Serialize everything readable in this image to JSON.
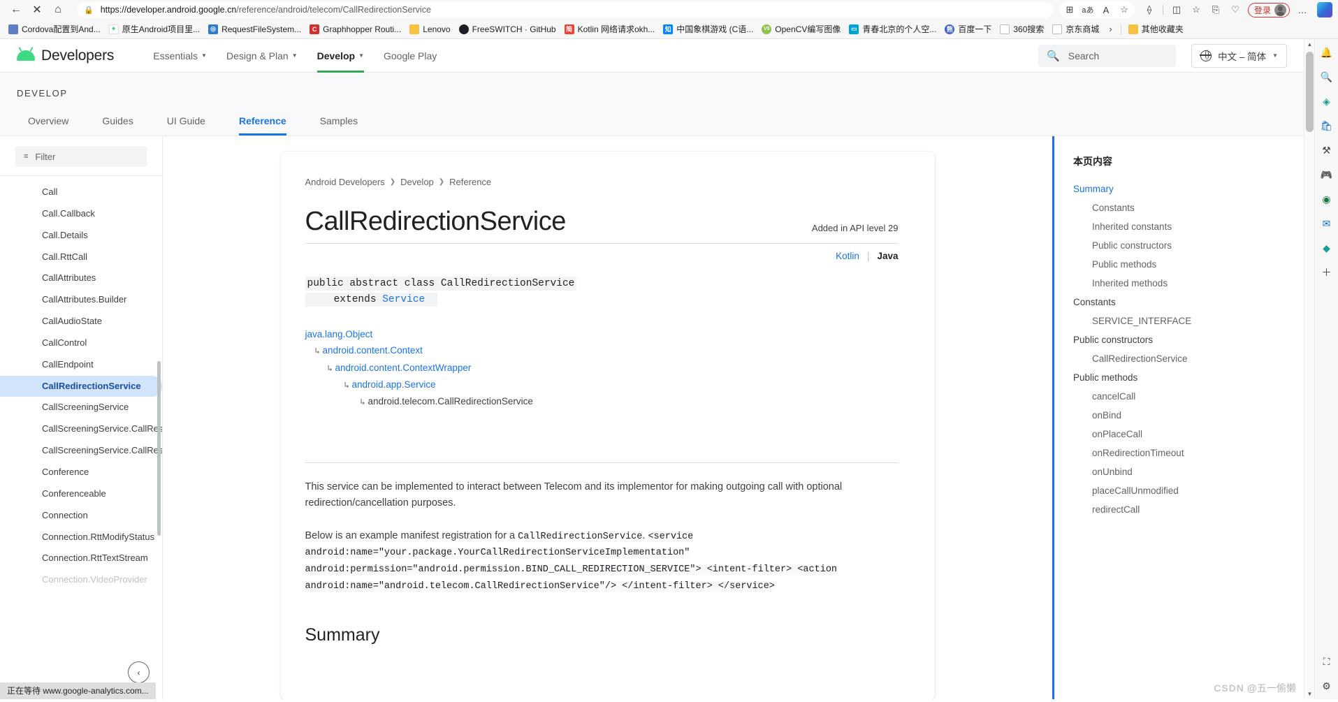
{
  "browser": {
    "nav": {
      "back": "←",
      "close": "✕",
      "home": "⌂"
    },
    "address": {
      "lock_icon": "lock-icon",
      "url_prefix": "https://developer.android.google.cn",
      "url_suffix": "/reference/android/telecom/CallRedirectionService"
    },
    "toolbar_icons": [
      {
        "name": "split-screen-icon",
        "glyph": "⊞"
      },
      {
        "name": "translate-icon",
        "glyph": "aあ"
      },
      {
        "name": "read-aloud-icon",
        "glyph": "A"
      },
      {
        "name": "favorite-star-icon",
        "glyph": "☆"
      },
      {
        "name": "extensions-icon",
        "glyph": "⟠"
      },
      {
        "name": "split-window-icon",
        "glyph": "◫"
      },
      {
        "name": "collections-icon",
        "glyph": "☆≡"
      },
      {
        "name": "add-tab-group-icon",
        "glyph": "⎘"
      },
      {
        "name": "browser-essentials-icon",
        "glyph": "♡"
      }
    ],
    "signin": {
      "label": "登录",
      "avatar": "avatar"
    },
    "more_icon": "…",
    "copilot_icon": "copilot-icon",
    "bookmarks": [
      {
        "label": "Cordova配置到And...",
        "color": "#5b7ec4",
        "letter": ""
      },
      {
        "label": "原生Android项目里...",
        "color": "#ffffff",
        "letter": ""
      },
      {
        "label": "RequestFileSystem...",
        "color": "#2b7cd3",
        "letter": "◎"
      },
      {
        "label": "Graphhopper Routi...",
        "color": "#d32f2f",
        "letter": "C"
      },
      {
        "label": "Lenovo",
        "color": "#f5c242",
        "letter": ""
      },
      {
        "label": "FreeSWITCH · GitHub",
        "color": "#1b1f23",
        "letter": ""
      },
      {
        "label": "Kotlin 网络请求okh...",
        "color": "#ef4136",
        "letter": "简"
      },
      {
        "label": "中国象棋游戏 (C语...",
        "color": "#0084ff",
        "letter": "知"
      },
      {
        "label": "OpenCV编写图像",
        "color": "#8bc34a",
        "letter": "V5"
      },
      {
        "label": "青春北京的个人空...",
        "color": "#00a1d6",
        "letter": ""
      },
      {
        "label": "百度一下",
        "color": "#3b5fd9",
        "letter": ""
      },
      {
        "label": "360搜索",
        "color": "#ffffff",
        "letter": ""
      },
      {
        "label": "京东商城",
        "color": "#ffffff",
        "letter": ""
      }
    ],
    "bookmark_overflow": "›",
    "other_favorites": {
      "label": "其他收藏夹",
      "color": "#f5c242"
    },
    "status_text": "正在等待 www.google-analytics.com..."
  },
  "site": {
    "brand": "Developers",
    "nav": [
      {
        "label": "Essentials",
        "has_caret": true,
        "active": false
      },
      {
        "label": "Design & Plan",
        "has_caret": true,
        "active": false
      },
      {
        "label": "Develop",
        "has_caret": true,
        "active": true
      },
      {
        "label": "Google Play",
        "has_caret": false,
        "active": false
      }
    ],
    "search_placeholder": "Search",
    "language": "中文 – 简体",
    "section_title": "DEVELOP",
    "tabs": [
      {
        "label": "Overview",
        "active": false
      },
      {
        "label": "Guides",
        "active": false
      },
      {
        "label": "UI Guide",
        "active": false
      },
      {
        "label": "Reference",
        "active": true
      },
      {
        "label": "Samples",
        "active": false
      }
    ]
  },
  "sidebar": {
    "filter_placeholder": "Filter",
    "items": [
      {
        "label": "Call",
        "state": "normal"
      },
      {
        "label": "Call.Callback",
        "state": "normal"
      },
      {
        "label": "Call.Details",
        "state": "normal"
      },
      {
        "label": "Call.RttCall",
        "state": "normal"
      },
      {
        "label": "CallAttributes",
        "state": "normal"
      },
      {
        "label": "CallAttributes.Builder",
        "state": "normal"
      },
      {
        "label": "CallAudioState",
        "state": "normal"
      },
      {
        "label": "CallControl",
        "state": "normal"
      },
      {
        "label": "CallEndpoint",
        "state": "normal"
      },
      {
        "label": "CallRedirectionService",
        "state": "active"
      },
      {
        "label": "CallScreeningService",
        "state": "normal"
      },
      {
        "label": "CallScreeningService.CallResponse",
        "state": "normal"
      },
      {
        "label": "CallScreeningService.CallResponse.Builder",
        "state": "normal"
      },
      {
        "label": "Conference",
        "state": "normal"
      },
      {
        "label": "Conferenceable",
        "state": "normal"
      },
      {
        "label": "Connection",
        "state": "normal"
      },
      {
        "label": "Connection.RttModifyStatus",
        "state": "normal"
      },
      {
        "label": "Connection.RttTextStream",
        "state": "normal"
      },
      {
        "label": "Connection.VideoProvider",
        "state": "faded"
      }
    ],
    "collapse_icon": "‹"
  },
  "article": {
    "breadcrumb": [
      "Android Developers",
      "Develop",
      "Reference"
    ],
    "breadcrumb_sep": "❯",
    "title": "CallRedirectionService",
    "api_level": "Added in API level 29",
    "lang_kotlin": "Kotlin",
    "lang_divider": "|",
    "lang_java": "Java",
    "signature": {
      "line1": "public abstract class CallRedirectionService",
      "line2_keyword": "extends",
      "line2_type": "Service"
    },
    "hierarchy": [
      {
        "label": "java.lang.Object",
        "depth": 0,
        "link": true
      },
      {
        "label": "android.content.Context",
        "depth": 1,
        "link": true
      },
      {
        "label": "android.content.ContextWrapper",
        "depth": 2,
        "link": true
      },
      {
        "label": "android.app.Service",
        "depth": 3,
        "link": true
      },
      {
        "label": "android.telecom.CallRedirectionService",
        "depth": 4,
        "link": false
      }
    ],
    "hierarchy_marker": "↳",
    "description": "This service can be implemented to interact between Telecom and its implementor for making outgoing call with optional redirection/cancellation purposes.",
    "example_intro_before": "Below is an example manifest registration for a",
    "example_intro_code": "CallRedirectionService",
    "example_intro_after": ".",
    "manifest_code": "<service android:name=\"your.package.YourCallRedirectionServiceImplementation\" android:permission=\"android.permission.BIND_CALL_REDIRECTION_SERVICE\"> <intent-filter> <action android:name=\"android.telecom.CallRedirectionService\"/> </intent-filter> </service>",
    "summary_heading": "Summary"
  },
  "toc": {
    "title": "本页内容",
    "items": [
      {
        "label": "Summary",
        "level": 1,
        "link": true
      },
      {
        "label": "Constants",
        "level": 2,
        "link": false
      },
      {
        "label": "Inherited constants",
        "level": 2,
        "link": false
      },
      {
        "label": "Public constructors",
        "level": 2,
        "link": false
      },
      {
        "label": "Public methods",
        "level": 2,
        "link": false
      },
      {
        "label": "Inherited methods",
        "level": 2,
        "link": false
      },
      {
        "label": "Constants",
        "level": 1,
        "link": false
      },
      {
        "label": "SERVICE_INTERFACE",
        "level": 2,
        "link": false
      },
      {
        "label": "Public constructors",
        "level": 1,
        "link": false
      },
      {
        "label": "CallRedirectionService",
        "level": 2,
        "link": false
      },
      {
        "label": "Public methods",
        "level": 1,
        "link": false
      },
      {
        "label": "cancelCall",
        "level": 2,
        "link": false
      },
      {
        "label": "onBind",
        "level": 2,
        "link": false
      },
      {
        "label": "onPlaceCall",
        "level": 2,
        "link": false
      },
      {
        "label": "onRedirectionTimeout",
        "level": 2,
        "link": false
      },
      {
        "label": "onUnbind",
        "level": 2,
        "link": false
      },
      {
        "label": "placeCallUnmodified",
        "level": 2,
        "link": false
      },
      {
        "label": "redirectCall",
        "level": 2,
        "link": false
      }
    ]
  },
  "edge_rail": [
    {
      "name": "notification-bell-icon",
      "glyph": "🔔"
    },
    {
      "name": "search-sidebar-icon",
      "glyph": "🔍"
    },
    {
      "name": "copilot-sidebar-icon",
      "glyph": "◈"
    },
    {
      "name": "shopping-icon",
      "glyph": "🛍"
    },
    {
      "name": "tools-icon",
      "glyph": "⚒"
    },
    {
      "name": "games-icon",
      "glyph": "🎮"
    },
    {
      "name": "office-icon",
      "glyph": "◉"
    },
    {
      "name": "outlook-icon",
      "glyph": "✉"
    },
    {
      "name": "drop-icon",
      "glyph": "◆"
    },
    {
      "name": "add-sidebar-icon",
      "glyph": "＋"
    },
    {
      "name": "screenshot-icon",
      "glyph": "⛶"
    },
    {
      "name": "settings-sidebar-icon",
      "glyph": "⚙"
    }
  ],
  "watermark": {
    "csdn": "CSDN",
    "handle": "@五一偷懒"
  }
}
